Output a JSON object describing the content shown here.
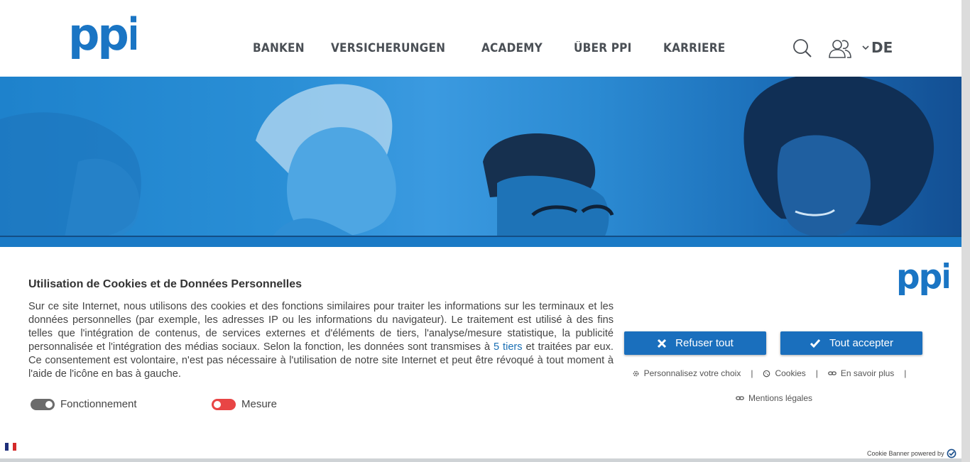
{
  "header": {
    "logo_text": "ppi",
    "nav": [
      "BANKEN",
      "VERSICHERUNGEN",
      "ACADEMY",
      "ÜBER PPI",
      "KARRIERE"
    ],
    "language": "DE"
  },
  "cookie_banner": {
    "title": "Utilisation de Cookies et de Données Personnelles",
    "text_before_link": "Sur ce site Internet, nous utilisons des cookies et des fonctions similaires pour traiter les informations sur les terminaux et les données personnelles (par exemple, les adresses IP ou les informations du navigateur). Le traitement est utilisé à des fins telles que l'intégration de contenus, de services externes et d'éléments de tiers, l'analyse/mesure statistique, la publicité personnalisée et l'intégration des médias sociaux. Selon la fonction, les données sont transmises à ",
    "link_text": "5 tiers",
    "text_after_link": " et traitées par eux. Ce consentement est volontaire, n'est pas nécessaire à l'utilisation de notre site Internet et peut être révoqué à tout moment à l'aide de l'icône en bas à gauche.",
    "toggles": [
      {
        "label": "Fonctionnement",
        "state": "on"
      },
      {
        "label": "Mesure",
        "state": "off"
      }
    ],
    "refuse_label": "Refuser tout",
    "accept_label": "Tout accepter",
    "links": [
      "Personnalisez votre choix",
      "Cookies",
      "En savoir plus",
      "Mentions légales"
    ],
    "separator": "|",
    "powered_by": "Cookie Banner powered by"
  },
  "colors": {
    "brand_blue": "#1a6fbd",
    "logo_blue": "#1a75c4",
    "toggle_on": "#6b6b6b",
    "toggle_off": "#e84545"
  }
}
